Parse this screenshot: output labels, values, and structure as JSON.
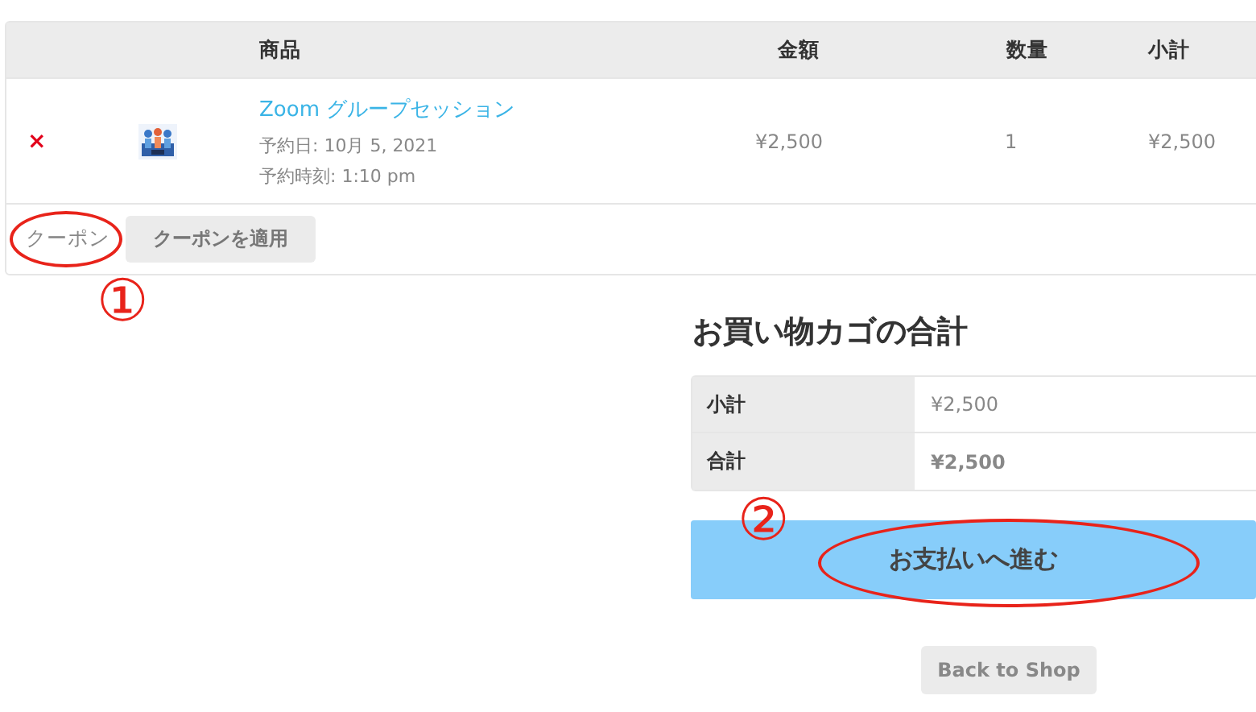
{
  "cart": {
    "columns": [
      "商品",
      "金額",
      "数量",
      "小計"
    ],
    "rows": [
      {
        "remove": "×",
        "product": "Zoom グループセッション",
        "meta": [
          "予約日: 10月 5, 2021",
          "予約時刻: 1:10 pm"
        ],
        "price": "¥2,500",
        "quantity": "1",
        "subtotal": "¥2,500"
      }
    ],
    "coupon": {
      "label": "クーポン",
      "circled": true,
      "marker": "①",
      "button": "クーポンを適用"
    }
  },
  "totals": {
    "title": "お買い物カゴの合計",
    "rows": [
      {
        "label": "小計",
        "value": "¥2,500",
        "kind": "plain"
      },
      {
        "label": "合計",
        "value": "¥2,500",
        "kind": "strong"
      }
    ],
    "checkout": {
      "label": "お支払いへ進む",
      "circled": true,
      "marker": "②"
    },
    "back": "Back to Shop"
  }
}
